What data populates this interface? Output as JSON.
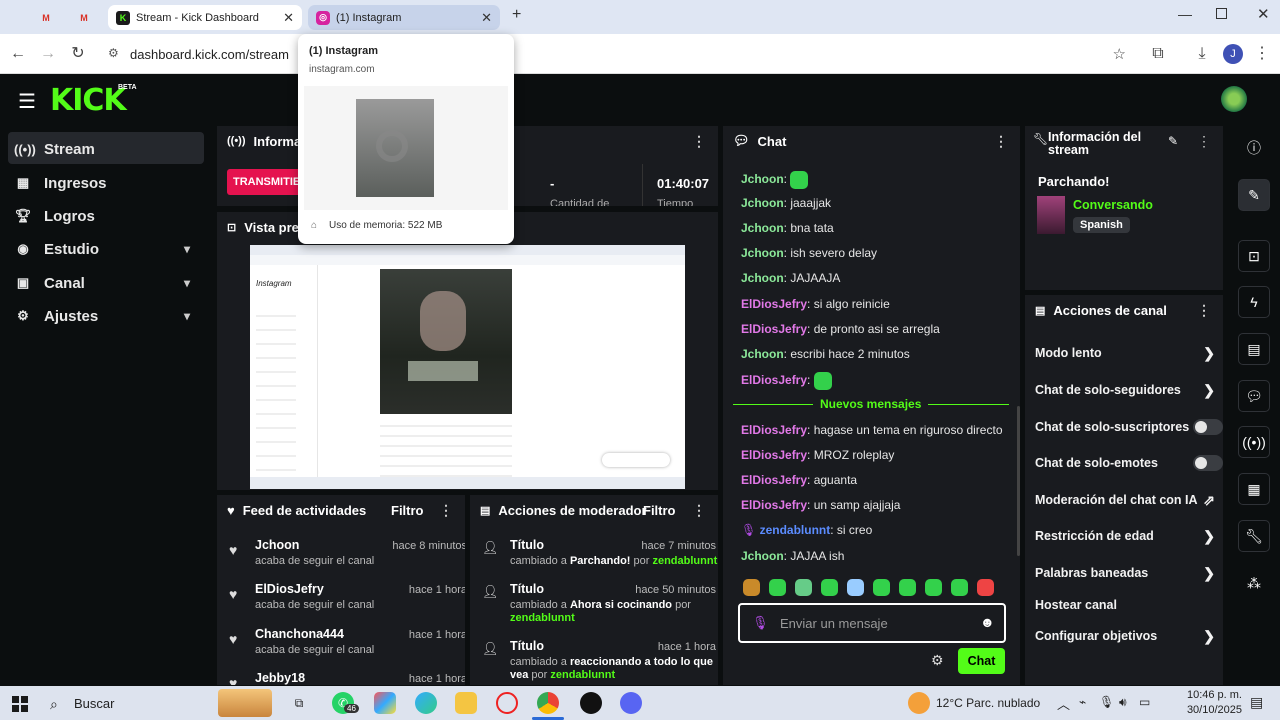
{
  "browser": {
    "tabs": [
      {
        "label": "",
        "icon": "gmail-icon"
      },
      {
        "label": "",
        "icon": "gmail-icon"
      },
      {
        "label": "Stream - Kick Dashboard",
        "icon": "kick-icon"
      },
      {
        "label": "(1) Instagram",
        "icon": "instagram-icon"
      }
    ],
    "url": "dashboard.kick.com/stream",
    "avatar_letter": "J"
  },
  "popup": {
    "title": "(1) Instagram",
    "domain": "instagram.com",
    "memory": "Uso de memoria: 522 MB"
  },
  "app": {
    "logo": "KICK",
    "logo_badge": "BETA",
    "accent": "#53fc18"
  },
  "sidebar": {
    "items": [
      {
        "label": "Stream",
        "icon": "stream-icon"
      },
      {
        "label": "Ingresos",
        "icon": "chart-icon"
      },
      {
        "label": "Logros",
        "icon": "trophy-icon"
      },
      {
        "label": "Estudio",
        "icon": "studio-icon"
      },
      {
        "label": "Canal",
        "icon": "channel-icon"
      },
      {
        "label": "Ajustes",
        "icon": "gear-icon"
      }
    ]
  },
  "info": {
    "title": "Informac",
    "live_badge": "TRANSMITIEN",
    "dash": "-",
    "uptime": "01:40:07",
    "label_cantidad": "Cantidad de",
    "label_tiempo": "Tiempo"
  },
  "preview": {
    "title": "Vista prev"
  },
  "feed": {
    "title": "Feed de actividades",
    "filter": "Filtro",
    "items": [
      {
        "name": "Jchoon",
        "time": "hace 8 minutos",
        "sub": "acaba de seguir el canal"
      },
      {
        "name": "ElDiosJefry",
        "time": "hace 1 hora",
        "sub": "acaba de seguir el canal"
      },
      {
        "name": "Chanchona444",
        "time": "hace 1 hora",
        "sub": "acaba de seguir el canal"
      },
      {
        "name": "Jebby18",
        "time": "hace 1 hora",
        "sub": ""
      }
    ]
  },
  "mod": {
    "title": "Acciones de moderador",
    "filter": "Filtro",
    "items": [
      {
        "title": "Título",
        "time": "hace 7 minutos",
        "pre": "cambiado a ",
        "value": "Parchando!",
        "by": " por ",
        "user": "zendablunnt"
      },
      {
        "title": "Título",
        "time": "hace 50 minutos",
        "pre": "cambiado a ",
        "value": "Ahora si cocinando",
        "by": " por ",
        "user": "zendablunnt"
      },
      {
        "title": "Título",
        "time": "hace 1 hora",
        "pre": "cambiado a ",
        "value": "reaccionando a todo lo que vea",
        "by": " por ",
        "user": "zendablunnt"
      }
    ]
  },
  "chat": {
    "title": "Chat",
    "messages": [
      {
        "user": "Jchoon",
        "text": "",
        "color": "#8ce99a",
        "emote": true
      },
      {
        "user": "Jchoon",
        "text": "jaaajjak",
        "color": "#8ce99a"
      },
      {
        "user": "Jchoon",
        "text": "bna tata",
        "color": "#8ce99a"
      },
      {
        "user": "Jchoon",
        "text": "ish severo delay",
        "color": "#8ce99a"
      },
      {
        "user": "Jchoon",
        "text": "JAJAAJA",
        "color": "#8ce99a"
      },
      {
        "user": "ElDiosJefry",
        "text": "si algo reinicie",
        "color": "#e279e8"
      },
      {
        "user": "ElDiosJefry",
        "text": "de pronto asi se arregla",
        "color": "#e279e8"
      },
      {
        "user": "Jchoon",
        "text": "escribi hace 2 minutos",
        "color": "#8ce99a"
      },
      {
        "user": "ElDiosJefry",
        "text": "",
        "color": "#e279e8",
        "emote": true
      }
    ],
    "new_messages_label": "Nuevos mensajes",
    "new_messages": [
      {
        "user": "ElDiosJefry",
        "text": "hagase un tema en riguroso directo",
        "color": "#e279e8"
      },
      {
        "user": "ElDiosJefry",
        "text": "MROZ roleplay",
        "color": "#e279e8"
      },
      {
        "user": "ElDiosJefry",
        "text": "aguanta",
        "color": "#e279e8"
      },
      {
        "user": "ElDiosJefry",
        "text": "un samp ajajjaja",
        "color": "#e279e8"
      },
      {
        "user": "zendablunnt",
        "text": "si creo",
        "color": "#5b8cff"
      },
      {
        "user": "Jchoon",
        "text": "JAJAA ish",
        "color": "#8ce99a"
      }
    ],
    "input_placeholder": "Enviar un mensaje",
    "send_label": "Chat"
  },
  "stream_info": {
    "title": "Información del stream",
    "stream_title": "Parchando!",
    "category": "Conversando",
    "language": "Spanish"
  },
  "channel_actions": {
    "title": "Acciones de canal",
    "items": [
      {
        "label": "Modo lento",
        "control": "chevron"
      },
      {
        "label": "Chat de solo-seguidores",
        "control": "chevron"
      },
      {
        "label": "Chat de solo-suscriptores",
        "control": "toggle"
      },
      {
        "label": "Chat de solo-emotes",
        "control": "toggle"
      },
      {
        "label": "Moderación del chat con IA",
        "control": "external"
      },
      {
        "label": "Restricción de edad",
        "control": "chevron"
      },
      {
        "label": "Palabras baneadas",
        "control": "chevron"
      },
      {
        "label": "Hostear canal",
        "control": "none"
      },
      {
        "label": "Configurar objetivos",
        "control": "chevron"
      }
    ]
  },
  "taskbar": {
    "search": "Buscar",
    "whatsapp_badge": "46",
    "weather": "12°C  Parc. nublado",
    "time": "10:46 p. m.",
    "date": "30/10/2025"
  }
}
